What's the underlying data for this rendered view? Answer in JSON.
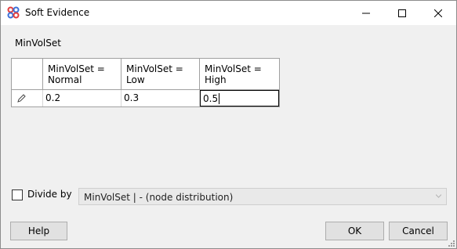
{
  "window": {
    "title": "Soft Evidence",
    "controls": [
      "minimize-icon",
      "maximize-icon",
      "close-icon"
    ]
  },
  "node": {
    "name": "MinVolSet"
  },
  "grid": {
    "headers": [
      "MinVolSet =\nNormal",
      "MinVolSet =\nLow",
      "MinVolSet =\nHigh"
    ],
    "row_icon": "pencil-icon",
    "values": [
      "0.2",
      "0.3",
      "0.5"
    ]
  },
  "divide": {
    "label": "Divide by",
    "checked": false,
    "selected": "MinVolSet | -  (node distribution)"
  },
  "buttons": {
    "help": "Help",
    "ok": "OK",
    "cancel": "Cancel"
  },
  "colors": {
    "icon_red": "#e23b3b",
    "icon_blue": "#3a6fd8"
  }
}
